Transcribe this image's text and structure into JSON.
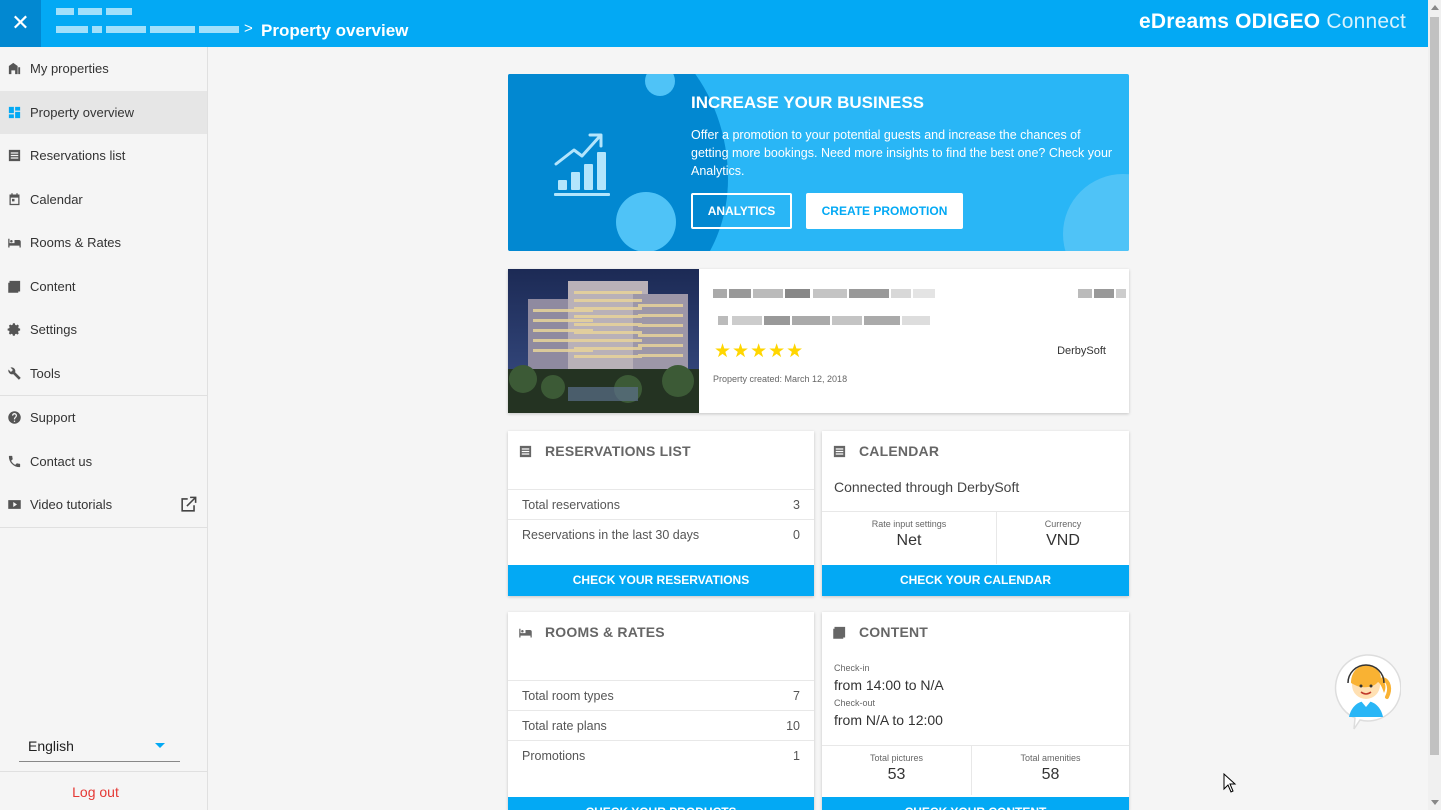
{
  "header": {
    "close_icon": "close-icon",
    "breadcrumb_separator": ">",
    "title": "Property overview",
    "brand_bold": "eDreams ODIGEO",
    "brand_light": "Connect"
  },
  "sidebar": {
    "items": [
      {
        "label": "My properties",
        "icon": "building-icon"
      },
      {
        "label": "Property overview",
        "icon": "dashboard-icon"
      },
      {
        "label": "Reservations list",
        "icon": "list-icon"
      },
      {
        "label": "Calendar",
        "icon": "calendar-icon"
      },
      {
        "label": "Rooms & Rates",
        "icon": "bed-icon"
      },
      {
        "label": "Content",
        "icon": "image-icon"
      },
      {
        "label": "Settings",
        "icon": "gear-icon"
      },
      {
        "label": "Tools",
        "icon": "wrench-icon"
      },
      {
        "label": "Support",
        "icon": "help-icon"
      },
      {
        "label": "Contact us",
        "icon": "phone-icon"
      },
      {
        "label": "Video tutorials",
        "icon": "video-icon"
      }
    ],
    "language": "English",
    "logout": "Log out"
  },
  "promo": {
    "title": "INCREASE YOUR BUSINESS",
    "text": "Offer a promotion to your potential guests and increase the chances of getting more bookings. Need more insights to find the best one? Check your Analytics.",
    "analytics_button": "ANALYTICS",
    "create_button": "CREATE PROMOTION"
  },
  "property": {
    "stars": "★★★★★",
    "star_rating": 5,
    "channel": "DerbySoft",
    "created": "Property created: March 12, 2018"
  },
  "reservations": {
    "title": "RESERVATIONS LIST",
    "rows": [
      {
        "label": "Total reservations",
        "value": "3"
      },
      {
        "label": "Reservations in the last 30 days",
        "value": "0"
      }
    ],
    "button": "CHECK YOUR RESERVATIONS"
  },
  "calendar": {
    "title": "CALENDAR",
    "connection": "Connected through DerbySoft",
    "rate_label": "Rate input settings",
    "rate_value": "Net",
    "currency_label": "Currency",
    "currency_value": "VND",
    "button": "CHECK YOUR CALENDAR"
  },
  "rooms": {
    "title": "ROOMS & RATES",
    "rows": [
      {
        "label": "Total room types",
        "value": "7"
      },
      {
        "label": "Total rate plans",
        "value": "10"
      },
      {
        "label": "Promotions",
        "value": "1"
      }
    ],
    "button": "CHECK YOUR PRODUCTS"
  },
  "content": {
    "title": "CONTENT",
    "checkin_label": "Check-in",
    "checkin_value": "from 14:00 to N/A",
    "checkout_label": "Check-out",
    "checkout_value": "from N/A to 12:00",
    "pictures_label": "Total pictures",
    "pictures_value": "53",
    "amenities_label": "Total amenities",
    "amenities_value": "58",
    "button": "CHECK YOUR CONTENT"
  },
  "colors": {
    "primary": "#03a9f4",
    "primary_dark": "#0288d1",
    "danger": "#e53935",
    "star": "#ffd600"
  }
}
